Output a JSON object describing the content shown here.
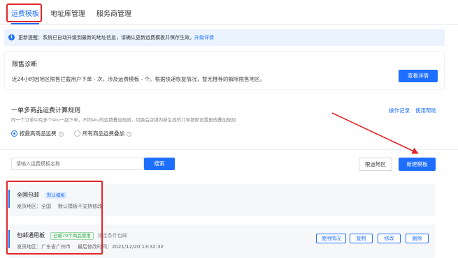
{
  "tabs": [
    {
      "label": "运费模板",
      "active": true
    },
    {
      "label": "地址库管理",
      "active": false
    },
    {
      "label": "服务商管理",
      "active": false
    }
  ],
  "notice": {
    "text": "更新提醒：系统已自动升级到最新的地址信息，请确认更新运费模板并保存生效。",
    "link": "升级详情"
  },
  "limit_card": {
    "title": "限售诊断",
    "desc": "近24小时因地区限售拦截用户下单 - 次，涉及运费模板 - 个。根据快递恢复情况，暂无推荐的解除限售地区。",
    "button": "查看详情"
  },
  "rule_card": {
    "title": "一单多商品运费计算规则",
    "sub": "同一个订单中有多个sku一起下单，不同sku的运费叠加规则，切换后店铺内新生成的订单按照设置更改叠加规则",
    "link_log": "操作记录",
    "link_help": "使用帮助",
    "options": [
      {
        "label": "按最高商品运费",
        "selected": true
      },
      {
        "label": "所有商品运费叠加",
        "selected": false
      }
    ]
  },
  "toolbar": {
    "search_placeholder": "请输入运费模板名称",
    "search_btn": "搜索",
    "restrict_btn": "限运地区",
    "new_btn": "新建模板"
  },
  "templates": [
    {
      "name": "全国包邮",
      "tag": "默认模板",
      "origin": "发货地区：全国",
      "note": "默认模板不支持修改"
    },
    {
      "name": "包邮通用板",
      "tag": "已被70个商品使用",
      "extra": "指定条件包邮",
      "origin": "发货地区：广东省广州市",
      "modified": "最后修改时间：2021/12/20 13:32:32",
      "actions": [
        "使用情况",
        "复制",
        "修改",
        "删除"
      ]
    }
  ],
  "colors": {
    "accent": "#1e6fff",
    "highlight_red": "#e3262a",
    "success_green": "#33a64a"
  }
}
